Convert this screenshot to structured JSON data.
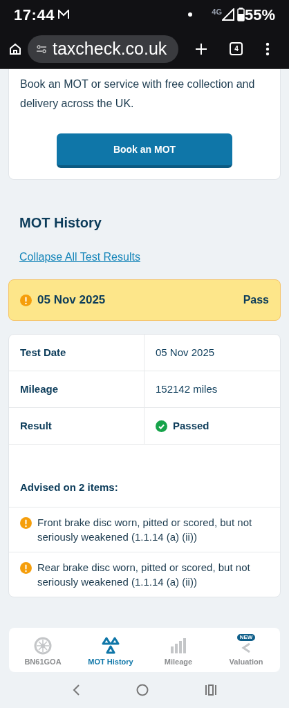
{
  "status_bar": {
    "time": "17:44",
    "network": "4G",
    "battery": "55%"
  },
  "browser": {
    "url": "taxcheck.co.uk",
    "tab_count": "4"
  },
  "promo": {
    "text": "Book an MOT or service with free collection and delivery across the UK.",
    "button": "Book an MOT"
  },
  "mot_history": {
    "title": "MOT History",
    "collapse_link": "Collapse All Test Results"
  },
  "test": {
    "date": "05 Nov 2025",
    "result": "Pass",
    "kind": "pass",
    "details": [
      {
        "label": "Test Date",
        "value": "05 Nov 2025",
        "kind": "text"
      },
      {
        "label": "Mileage",
        "value": "152142 miles",
        "kind": "text"
      },
      {
        "label": "Result",
        "value": "Passed",
        "kind": "passed"
      }
    ],
    "advisory_title": "Advised on 2 items:",
    "advisories": [
      "Front brake disc worn, pitted or scored, but not seriously weakened (1.1.14 (a) (ii))",
      "Rear brake disc worn, pitted or scored, but not seriously weakened (1.1.14 (a) (ii))"
    ]
  },
  "bottom_nav": [
    {
      "label": "BN61GOA",
      "kind": "tyre",
      "selected": false
    },
    {
      "label": "MOT History",
      "kind": "mot",
      "selected": true
    },
    {
      "label": "Mileage",
      "kind": "bars",
      "selected": false
    },
    {
      "label": "Valuation",
      "kind": "valuation",
      "selected": false,
      "badge": "NEW"
    }
  ]
}
